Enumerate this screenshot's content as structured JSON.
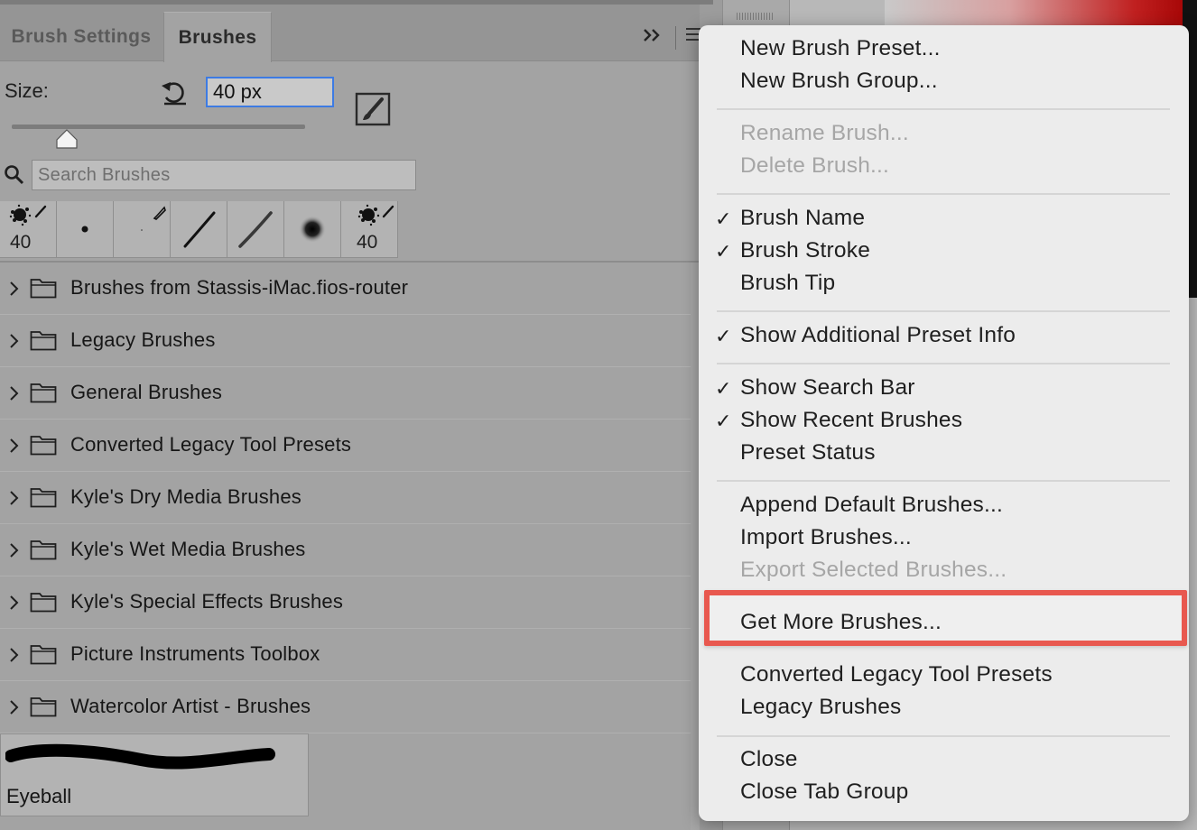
{
  "panel": {
    "tabs": [
      {
        "label": "Brush Settings",
        "active": false
      },
      {
        "label": "Brushes",
        "active": true
      }
    ],
    "collapse_icon": "double-chevron-right-icon",
    "menu_icon": "hamburger-menu-icon",
    "size": {
      "label": "Size:",
      "value": "40 px",
      "slider_value_fraction": 0.15
    },
    "search": {
      "placeholder": "Search Brushes"
    },
    "recent_brushes": [
      {
        "icon": "spatter-brush-icon",
        "size": "40"
      },
      {
        "icon": "round-dot-brush-icon",
        "size": ""
      },
      {
        "icon": "pencil-brush-icon",
        "size": ""
      },
      {
        "icon": "hard-stroke-brush-icon",
        "size": ""
      },
      {
        "icon": "soft-stroke-brush-icon",
        "size": ""
      },
      {
        "icon": "soft-round-brush-icon",
        "size": ""
      },
      {
        "icon": "spatter-brush-icon",
        "size": "40"
      }
    ],
    "groups": [
      "Brushes from Stassis-iMac.fios-router",
      "Legacy Brushes",
      "General Brushes",
      "Converted Legacy Tool Presets",
      "Kyle's Dry Media Brushes",
      "Kyle's Wet Media Brushes",
      "Kyle's Special Effects Brushes",
      "Picture Instruments Toolbox",
      "Watercolor Artist - Brushes"
    ],
    "brush_preview": {
      "name": "Eyeball"
    }
  },
  "menu": {
    "items": [
      {
        "label": "New Brush Preset...",
        "checked": false,
        "disabled": false
      },
      {
        "label": "New Brush Group...",
        "checked": false,
        "disabled": false
      },
      {
        "label": "Rename Brush...",
        "checked": false,
        "disabled": true
      },
      {
        "label": "Delete Brush...",
        "checked": false,
        "disabled": true
      },
      {
        "label": "Brush Name",
        "checked": true,
        "disabled": false
      },
      {
        "label": "Brush Stroke",
        "checked": true,
        "disabled": false
      },
      {
        "label": "Brush Tip",
        "checked": false,
        "disabled": false
      },
      {
        "label": "Show Additional Preset Info",
        "checked": true,
        "disabled": false
      },
      {
        "label": "Show Search Bar",
        "checked": true,
        "disabled": false
      },
      {
        "label": "Show Recent Brushes",
        "checked": true,
        "disabled": false
      },
      {
        "label": "Preset Status",
        "checked": false,
        "disabled": false
      },
      {
        "label": "Append Default Brushes...",
        "checked": false,
        "disabled": false
      },
      {
        "label": "Import Brushes...",
        "checked": false,
        "disabled": false
      },
      {
        "label": "Export Selected Brushes...",
        "checked": false,
        "disabled": true
      },
      {
        "label": "Get More Brushes...",
        "checked": false,
        "disabled": false,
        "highlighted": true
      },
      {
        "label": "Converted Legacy Tool Presets",
        "checked": false,
        "disabled": false
      },
      {
        "label": "Legacy Brushes",
        "checked": false,
        "disabled": false
      },
      {
        "label": "Close",
        "checked": false,
        "disabled": false
      },
      {
        "label": "Close Tab Group",
        "checked": false,
        "disabled": false
      }
    ],
    "check_glyph": "✓",
    "highlight_color": "#e8584f"
  }
}
